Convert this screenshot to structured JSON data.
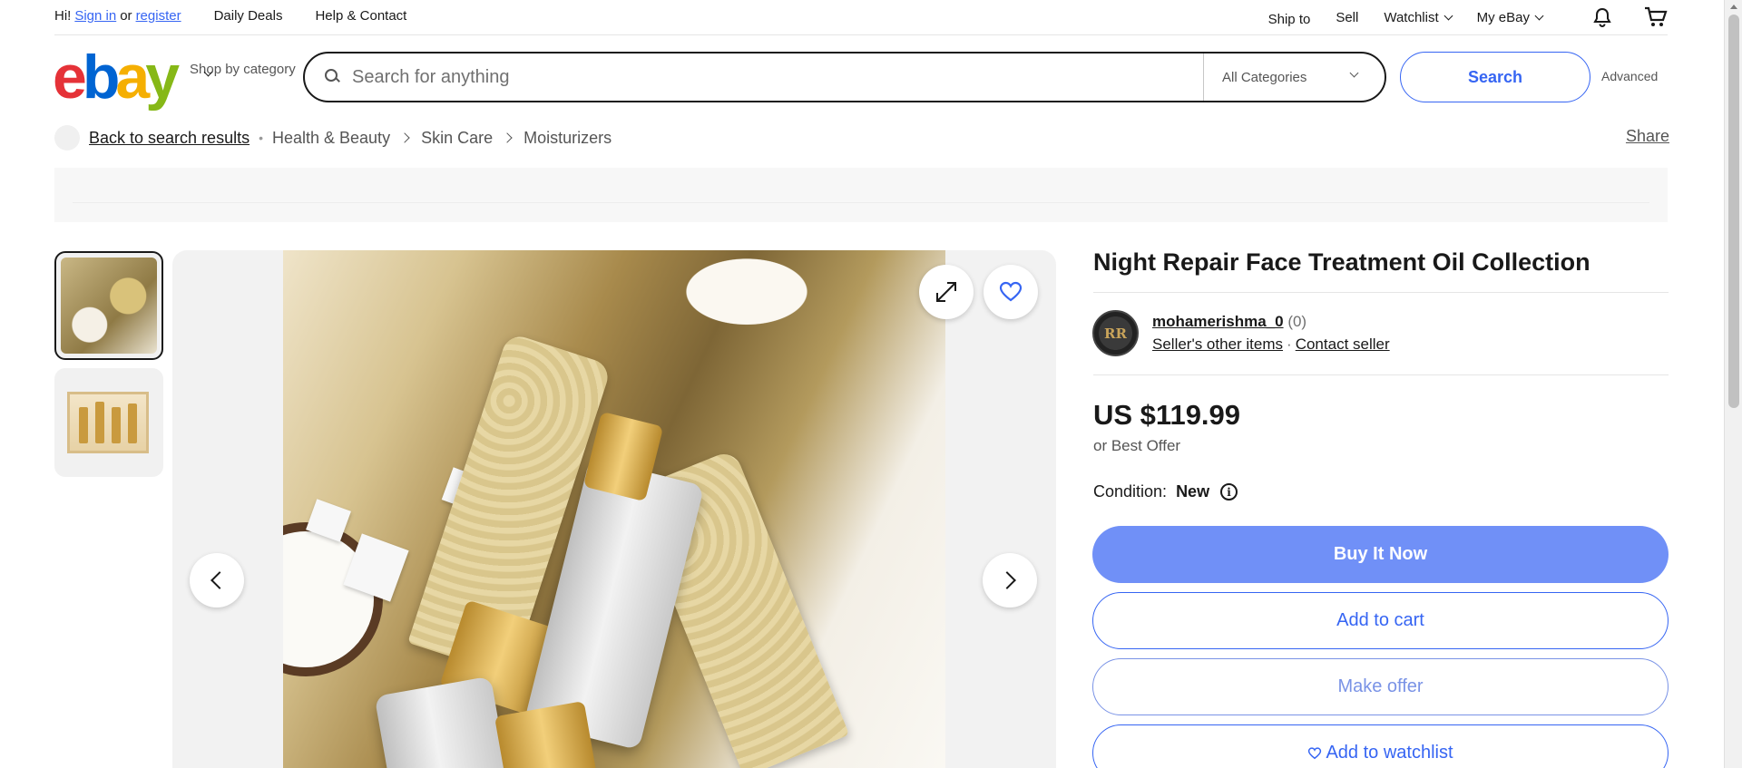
{
  "topbar": {
    "greeting": "Hi!",
    "sign_in": "Sign in",
    "or": "or",
    "register": "register",
    "daily_deals": "Daily Deals",
    "help_contact": "Help & Contact",
    "ship_to": "Ship to",
    "sell": "Sell",
    "watchlist": "Watchlist",
    "my_ebay": "My eBay"
  },
  "header": {
    "logo": {
      "e": "e",
      "b": "b",
      "a": "a",
      "y": "y"
    },
    "shop_by_category": "Shop by category",
    "search_placeholder": "Search for anything",
    "category_select": "All Categories",
    "search_button": "Search",
    "advanced": "Advanced"
  },
  "breadcrumb": {
    "back": "Back to search results",
    "items": [
      "Health & Beauty",
      "Skin Care",
      "Moisturizers"
    ],
    "share": "Share"
  },
  "product": {
    "title": "Night Repair Face Treatment Oil Collection",
    "seller": {
      "name": "mohamerishma_0",
      "feedback": "(0)",
      "other_items": "Seller's other items",
      "contact": "Contact seller",
      "avatar_text": "RR"
    },
    "price": "US $119.99",
    "best_offer": "or Best Offer",
    "condition_label": "Condition:",
    "condition_value": "New",
    "buttons": {
      "buy_now": "Buy It Now",
      "add_to_cart": "Add to cart",
      "make_offer": "Make offer",
      "add_to_watchlist": "Add to watchlist"
    }
  },
  "icons": {
    "search": "search-icon",
    "bell": "bell-icon",
    "cart": "cart-icon",
    "expand": "expand-icon",
    "heart": "heart-icon",
    "info": "info-icon"
  },
  "colors": {
    "accent": "#3665f3",
    "buy_button": "#7090f7"
  }
}
